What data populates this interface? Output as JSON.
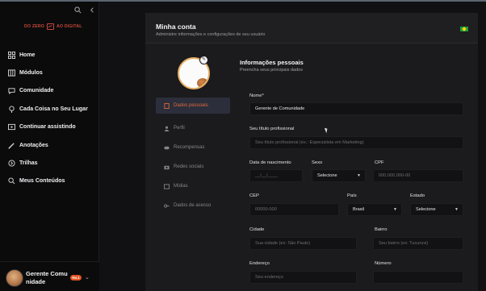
{
  "brand": {
    "logo_left": "DO ZERO",
    "logo_right": "AO DIGITAL"
  },
  "sidebar": {
    "tools": [
      "search-icon",
      "collapse-icon"
    ],
    "items": [
      {
        "label": "Home",
        "icon": "grid-icon"
      },
      {
        "label": "Módulos",
        "icon": "modules-icon"
      },
      {
        "label": "Comunidade",
        "icon": "chat-icon"
      },
      {
        "label": "Cada Coisa no Seu Lugar",
        "icon": "pin-icon"
      },
      {
        "label": "Continuar assistindo",
        "icon": "play-icon"
      },
      {
        "label": "Anotações",
        "icon": "pencil-icon"
      },
      {
        "label": "Trilhas",
        "icon": "arrow-circle-icon"
      },
      {
        "label": "Meus Conteúdos",
        "icon": "search-icon"
      }
    ],
    "profile": {
      "name": "Gerente Comu nidade",
      "badge": "Nv.1"
    }
  },
  "account": {
    "title": "Minha conta",
    "subtitle": "Administre informações e configurações de seu usuário",
    "flag": "brazil-flag-icon"
  },
  "menu": {
    "items": [
      {
        "label": "Dados pessoais",
        "active": true
      },
      {
        "label": "Perfil"
      },
      {
        "label": "Recompensas"
      },
      {
        "label": "Redes sociais"
      },
      {
        "label": "Mídias"
      },
      {
        "label": "Dados de acesso"
      }
    ]
  },
  "personal": {
    "title": "Informações pessoais",
    "subtitle": "Preencha seus principais dados",
    "name_label": "Nome*",
    "name_value": "Gerente de Comunidade",
    "job_label": "Seu título profissional",
    "job_placeholder": "Seu título profissional (ex.: Especialista em Marketing)",
    "birth_label": "Data de nascimento",
    "birth_placeholder": "__/__/____",
    "sex_label": "Sexo",
    "sex_value": "Selecione",
    "cpf_label": "CPF",
    "cpf_placeholder": "000.000.000-00",
    "cep_label": "CEP",
    "cep_placeholder": "00000-000",
    "country_label": "País",
    "country_value": "Brasil",
    "state_label": "Estado",
    "state_value": "Selecione",
    "city_label": "Cidade",
    "city_placeholder": "Sua cidade (ex: São Paulo)",
    "district_label": "Bairro",
    "district_placeholder": "Seu bairro (ex: Tucuruvi)",
    "address_label": "Endereço",
    "address_placeholder": "Seu endereço",
    "number_label": "Número",
    "number_placeholder": ""
  }
}
